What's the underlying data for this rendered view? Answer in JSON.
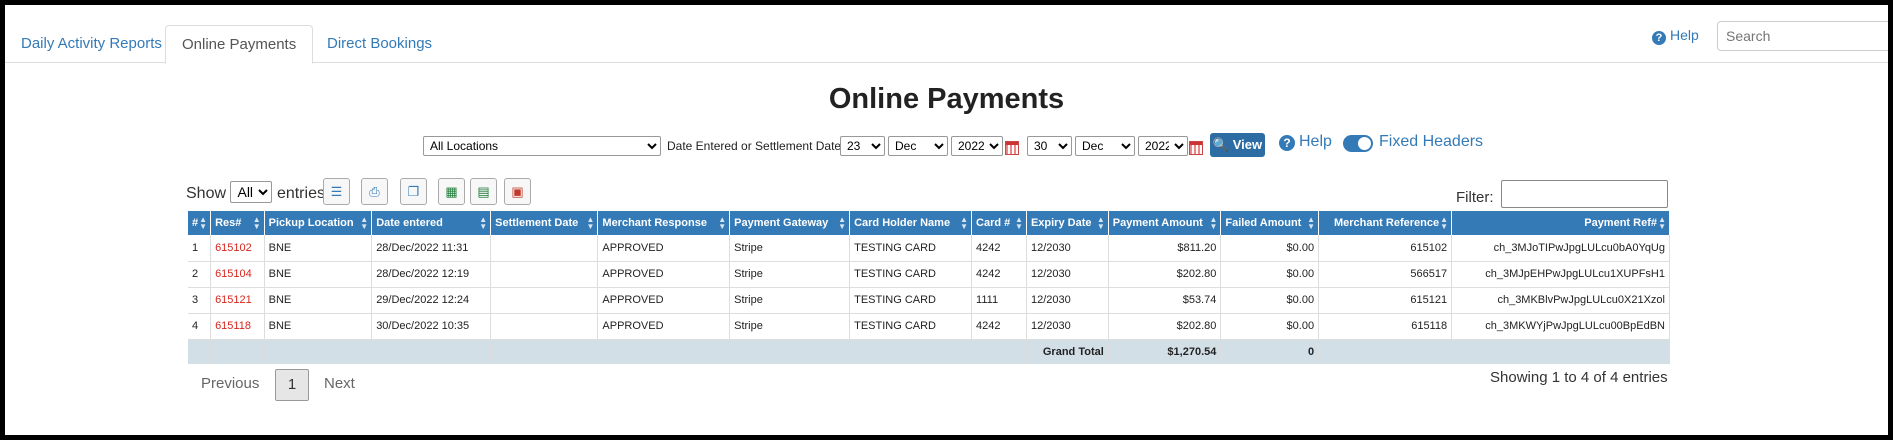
{
  "nav": {
    "tabs": [
      {
        "label": "Daily Activity Reports"
      },
      {
        "label": "Online Payments"
      },
      {
        "label": "Direct Bookings"
      }
    ],
    "help_label": "Help",
    "search_placeholder": "Search"
  },
  "page_title": "Online Payments",
  "filters": {
    "location": "All Locations",
    "date_label": "Date Entered or Settlement Date",
    "from_day": "23",
    "from_month": "Dec",
    "from_year": "2022",
    "to_day": "30",
    "to_month": "Dec",
    "to_year": "2022",
    "view_label": "View",
    "help_label": "Help",
    "fixed_headers_label": "Fixed Headers",
    "fixed_headers_on": true
  },
  "table_controls": {
    "show_label": "Show",
    "entries_value": "All",
    "entries_label": "entries",
    "filter_label": "Filter:"
  },
  "table": {
    "columns": [
      "#",
      "Res#",
      "Pickup Location",
      "Date entered",
      "Settlement Date",
      "Merchant Response",
      "Payment Gateway",
      "Card Holder Name",
      "Card #",
      "Expiry Date",
      "Payment Amount",
      "Failed Amount",
      "Merchant Reference",
      "Payment Ref#"
    ],
    "rows": [
      [
        "1",
        "615102",
        "BNE",
        "28/Dec/2022 11:31",
        "",
        "APPROVED",
        "Stripe",
        "TESTING CARD",
        "4242",
        "12/2030",
        "$811.20",
        "$0.00",
        "615102",
        "ch_3MJoTIPwJpgLULcu0bA0YqUg"
      ],
      [
        "2",
        "615104",
        "BNE",
        "28/Dec/2022 12:19",
        "",
        "APPROVED",
        "Stripe",
        "TESTING CARD",
        "4242",
        "12/2030",
        "$202.80",
        "$0.00",
        "566517",
        "ch_3MJpEHPwJpgLULcu1XUPFsH1"
      ],
      [
        "3",
        "615121",
        "BNE",
        "29/Dec/2022 12:24",
        "",
        "APPROVED",
        "Stripe",
        "TESTING CARD",
        "1111",
        "12/2030",
        "$53.74",
        "$0.00",
        "615121",
        "ch_3MKBlvPwJpgLULcu0X21Xzol"
      ],
      [
        "4",
        "615118",
        "BNE",
        "30/Dec/2022 10:35",
        "",
        "APPROVED",
        "Stripe",
        "TESTING CARD",
        "4242",
        "12/2030",
        "$202.80",
        "$0.00",
        "615118",
        "ch_3MKWYjPwJpgLULcu00BpEdBN"
      ]
    ],
    "total": {
      "label": "Grand Total",
      "payment": "$1,270.54",
      "failed": "0"
    }
  },
  "pagination": {
    "previous": "Previous",
    "page": "1",
    "next": "Next",
    "info": "Showing 1 to 4 of 4 entries"
  },
  "colors": {
    "accent": "#337ab7",
    "res_link": "#d9251d",
    "total_row": "#d3dfe7"
  }
}
